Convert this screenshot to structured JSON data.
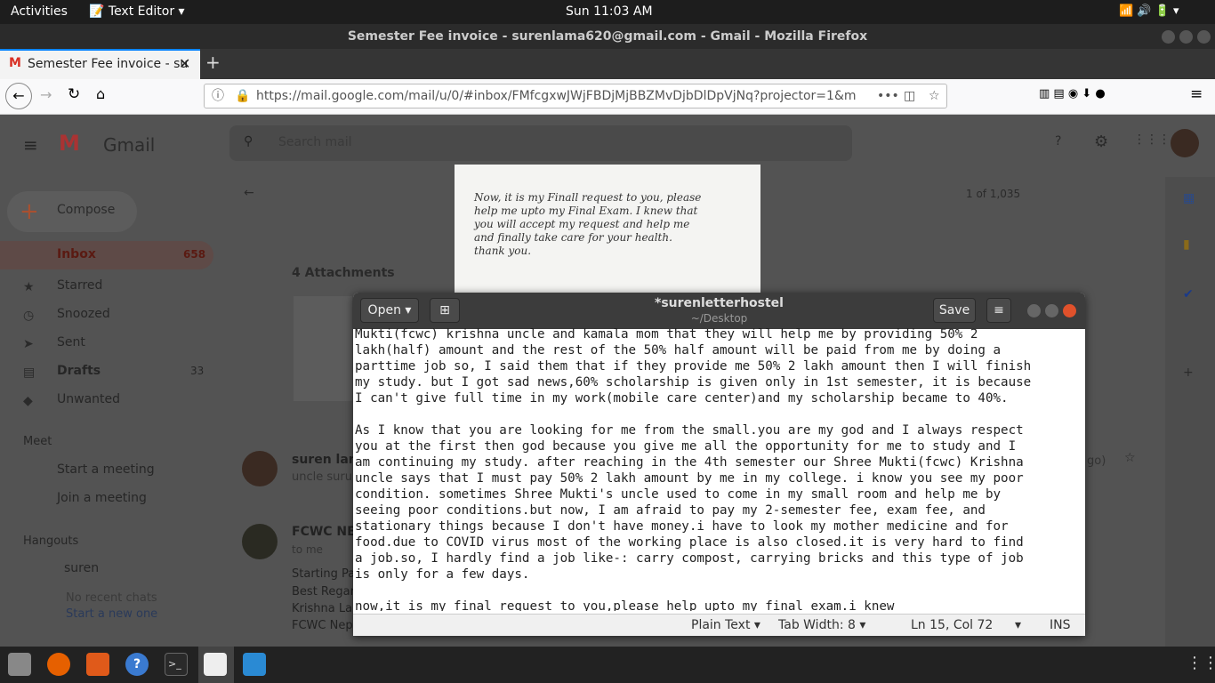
{
  "topbar": {
    "activities": "Activities",
    "app": "Text Editor",
    "clock": "Sun 11:03 AM"
  },
  "firefox": {
    "title": "Semester Fee invoice - surenlama620@gmail.com - Gmail - Mozilla Firefox",
    "tab_label": "Semester Fee invoice - su",
    "url": "https://mail.google.com/mail/u/0/#inbox/FMfcgxwJWjFBDjMjBBZMvDjbDlDpVjNq?projector=1&m"
  },
  "gmail": {
    "logo": "Gmail",
    "search_placeholder": "Search mail",
    "compose": "Compose",
    "nav": [
      {
        "label": "Inbox",
        "count": "658"
      },
      {
        "label": "Starred",
        "count": ""
      },
      {
        "label": "Snoozed",
        "count": ""
      },
      {
        "label": "Sent",
        "count": ""
      },
      {
        "label": "Drafts",
        "count": "33"
      },
      {
        "label": "Unwanted",
        "count": ""
      }
    ],
    "meet_title": "Meet",
    "meet_items": [
      "Start a meeting",
      "Join a meeting"
    ],
    "hangouts_title": "Hangouts",
    "hangouts_user": "suren",
    "no_chats": "No recent chats",
    "start_new": "Start a new one",
    "pager": "1 of 1,035",
    "attachments": "4 Attachments",
    "sender1": "suren lam",
    "snippet1": "uncle suru",
    "ago": "go)",
    "sender2": "FCWC NE",
    "to_me": "to me",
    "body_lines": [
      "Starting Pa",
      "Best Regar",
      "Krishna La",
      "FCWC Nep"
    ]
  },
  "photo": {
    "lines": [
      "Now, it is my Finall request to you, please",
      "help me upto my Final Exam. I knew that",
      "you will accept my request and help me",
      "and finally take care for your health.",
      "thank you."
    ]
  },
  "gedit": {
    "open": "Open",
    "save": "Save",
    "title": "*surenletterhostel",
    "subtitle": "~/Desktop",
    "text": "Mukti(fcwc) krishna uncle and kamala mom that they will help me by providing 50% 2\nlakh(half) amount and the rest of the 50% half amount will be paid from me by doing a\nparttime job so, I said them that if they provide me 50% 2 lakh amount then I will finish\nmy study. but I got sad news,60% scholarship is given only in 1st semester, it is because\nI can't give full time in my work(mobile care center)and my scholarship became to 40%.\n\nAs I know that you are looking for me from the small.you are my god and I always respect\nyou at the first then god because you give me all the opportunity for me to study and I\nam continuing my study. after reaching in the 4th semester our Shree Mukti(fcwc) Krishna\nuncle says that I must pay 50% 2 lakh amount by me in my college. i know you see my poor\ncondition. sometimes Shree Mukti's uncle used to come in my small room and help me by\nseeing poor conditions.but now, I am afraid to pay my 2-semester fee, exam fee, and\nstationary things because I don't have money.i have to look my mother medicine and for\nfood.due to COVID virus most of the working place is also closed.it is very hard to find\na job.so, I hardly find a job like-: carry compost, carrying bricks and this type of job\nis only for a few days.\n\nnow,it is my final request to you,please help upto my final exam.i knew",
    "status": {
      "lang": "Plain Text",
      "tab": "Tab Width: 8",
      "pos": "Ln 15, Col 72",
      "mode": "INS"
    }
  }
}
